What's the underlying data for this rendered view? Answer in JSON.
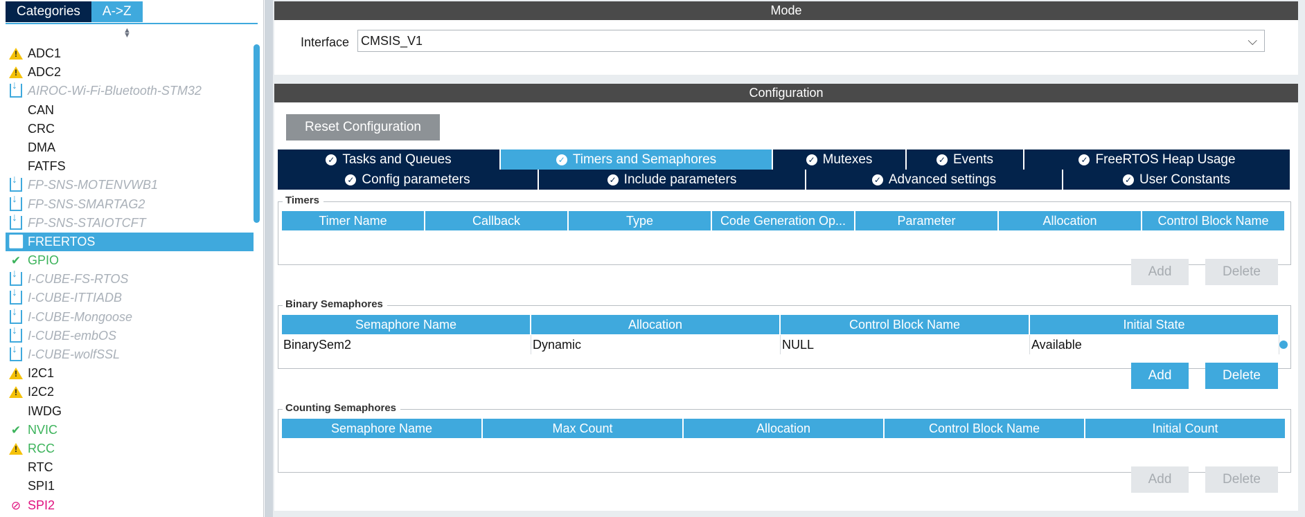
{
  "left_panel": {
    "tabs": [
      "Categories",
      "A->Z"
    ],
    "items": [
      {
        "label": "ADC1",
        "status": "warn"
      },
      {
        "label": "ADC2",
        "status": "warn"
      },
      {
        "label": "AIROC-Wi-Fi-Bluetooth-STM32",
        "status": "download"
      },
      {
        "label": "CAN",
        "status": "none"
      },
      {
        "label": "CRC",
        "status": "none"
      },
      {
        "label": "DMA",
        "status": "none"
      },
      {
        "label": "FATFS",
        "status": "none"
      },
      {
        "label": "FP-SNS-MOTENVWB1",
        "status": "download"
      },
      {
        "label": "FP-SNS-SMARTAG2",
        "status": "download"
      },
      {
        "label": "FP-SNS-STAIOTCFT",
        "status": "download"
      },
      {
        "label": "FREERTOS",
        "status": "selected"
      },
      {
        "label": "GPIO",
        "status": "ok"
      },
      {
        "label": "I-CUBE-FS-RTOS",
        "status": "download"
      },
      {
        "label": "I-CUBE-ITTIADB",
        "status": "download"
      },
      {
        "label": "I-CUBE-Mongoose",
        "status": "download"
      },
      {
        "label": "I-CUBE-embOS",
        "status": "download"
      },
      {
        "label": "I-CUBE-wolfSSL",
        "status": "download"
      },
      {
        "label": "I2C1",
        "status": "warn"
      },
      {
        "label": "I2C2",
        "status": "warn"
      },
      {
        "label": "IWDG",
        "status": "none"
      },
      {
        "label": "NVIC",
        "status": "ok"
      },
      {
        "label": "RCC",
        "status": "warn-green"
      },
      {
        "label": "RTC",
        "status": "none"
      },
      {
        "label": "SPI1",
        "status": "none"
      },
      {
        "label": "SPI2",
        "status": "disabled"
      }
    ]
  },
  "mode": {
    "title": "Mode",
    "interface_label": "Interface",
    "interface_value": "CMSIS_V1"
  },
  "configuration": {
    "title": "Configuration",
    "reset_label": "Reset Configuration",
    "tabs_row1": [
      "Tasks and Queues",
      "Timers and Semaphores",
      "Mutexes",
      "Events",
      "FreeRTOS Heap Usage"
    ],
    "tabs_row2": [
      "Config parameters",
      "Include parameters",
      "Advanced settings",
      "User Constants"
    ],
    "active_tab": "Timers and Semaphores",
    "timers": {
      "title": "Timers",
      "columns": [
        "Timer Name",
        "Callback",
        "Type",
        "Code Generation Op...",
        "Parameter",
        "Allocation",
        "Control Block Name"
      ],
      "add_label": "Add",
      "delete_label": "Delete"
    },
    "binary_semaphores": {
      "title": "Binary Semaphores",
      "columns": [
        "Semaphore Name",
        "Allocation",
        "Control Block Name",
        "Initial State"
      ],
      "rows": [
        [
          "BinarySem2",
          "Dynamic",
          "NULL",
          "Available"
        ]
      ],
      "add_label": "Add",
      "delete_label": "Delete"
    },
    "counting_semaphores": {
      "title": "Counting Semaphores",
      "columns": [
        "Semaphore Name",
        "Max Count",
        "Allocation",
        "Control Block Name",
        "Initial Count"
      ],
      "add_label": "Add",
      "delete_label": "Delete"
    }
  }
}
